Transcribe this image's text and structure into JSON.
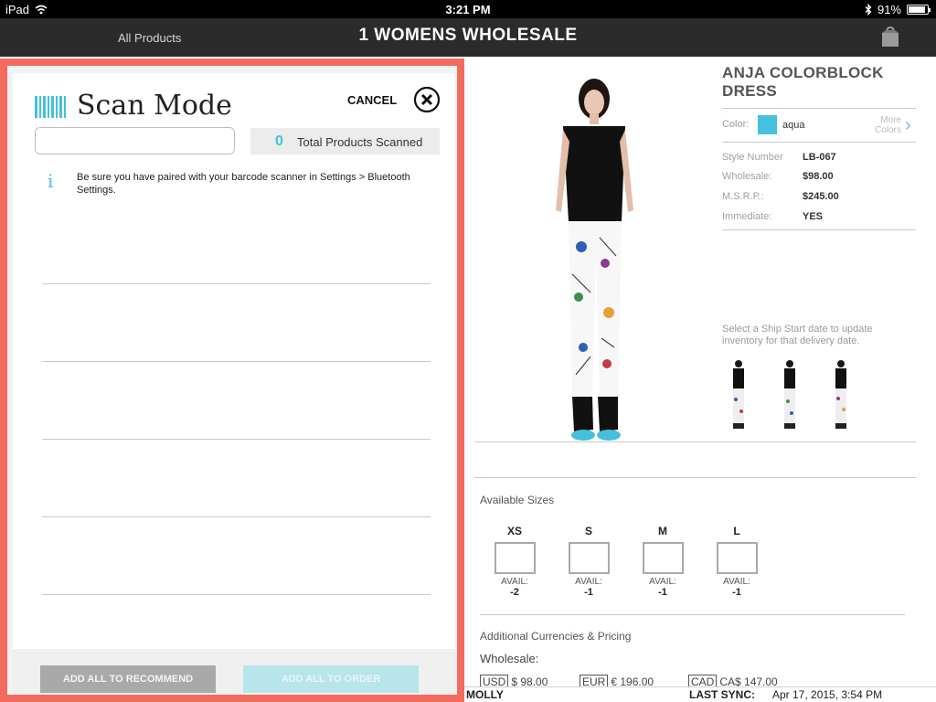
{
  "status_bar": {
    "device": "iPad",
    "time": "3:21 PM",
    "battery": "91%",
    "battery_level": 0.91
  },
  "nav": {
    "back_label": "All Products",
    "title": "1 WOMENS WHOLESALE"
  },
  "product": {
    "name": "ANJA COLORBLOCK DRESS",
    "color_label": "Color:",
    "color_name": "aqua",
    "color_hex": "#45c0dd",
    "more_colors": "More Colors",
    "specs": [
      {
        "label": "Style Number",
        "value": "LB-067"
      },
      {
        "label": "Wholesale:",
        "value": "$98.00"
      },
      {
        "label": "M.S.R.P.:",
        "value": "$245.00"
      },
      {
        "label": "Immediate:",
        "value": "YES"
      }
    ],
    "ship_note": "Select a Ship Start date to update inventory for that delivery date.",
    "sizes_title": "Available Sizes",
    "sizes": [
      {
        "size": "XS",
        "avail_label": "AVAIL:",
        "avail": "-2"
      },
      {
        "size": "S",
        "avail_label": "AVAIL:",
        "avail": "-1"
      },
      {
        "size": "M",
        "avail_label": "AVAIL:",
        "avail": "-1"
      },
      {
        "size": "L",
        "avail_label": "AVAIL:",
        "avail": "-1"
      }
    ],
    "currencies_title": "Additional Currencies & Pricing",
    "wholesale_label": "Wholesale:",
    "prices": [
      {
        "code": "USD",
        "value": "$ 98.00"
      },
      {
        "code": "EUR",
        "value": "€ 196.00"
      },
      {
        "code": "CAD",
        "value": "CA$ 147.00"
      }
    ]
  },
  "bottom_bar": {
    "user": "MOLLY",
    "sync_label": "LAST SYNC:",
    "sync_value": "Apr 17, 2015, 3:54 PM"
  },
  "scan_mode": {
    "title": "Scan Mode",
    "cancel_label": "CANCEL",
    "input_value": "",
    "count": "0",
    "count_label": "Total Products Scanned",
    "info_icon": "i",
    "info_text": "Be sure you have paired with your barcode scanner in Settings > Bluetooth Settings.",
    "add_recommend_label": "ADD ALL TO RECOMMEND",
    "add_order_label": "ADD ALL TO ORDER"
  },
  "colors": {
    "accent": "#45c0dd",
    "modal_border": "#f26b5e",
    "navbar": "#2b2b2b"
  }
}
